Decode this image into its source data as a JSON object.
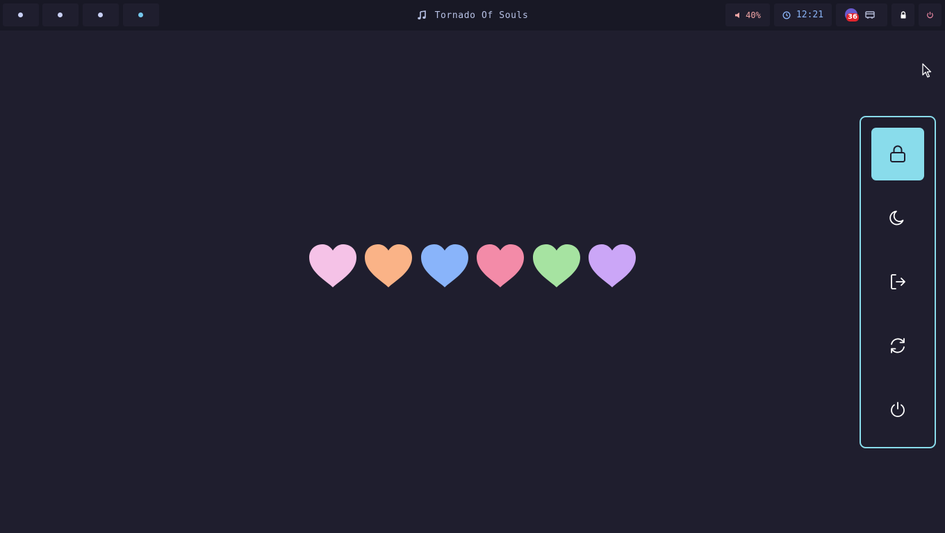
{
  "topbar": {
    "workspaces": [
      {
        "label": "workspace-1",
        "active": false
      },
      {
        "label": "workspace-2",
        "active": false
      },
      {
        "label": "workspace-3",
        "active": false
      },
      {
        "label": "workspace-4",
        "active": true
      }
    ],
    "now_playing": {
      "icon": "music-note-icon",
      "title": "Tornado Of Souls"
    },
    "volume": {
      "icon": "speaker-icon",
      "value": "40%"
    },
    "clock": {
      "icon": "clock-icon",
      "time": "12:21"
    },
    "tray": {
      "badge_count": "36",
      "items": [
        "notification-badge-icon",
        "network-icon"
      ]
    },
    "lock_icon": "lock-icon",
    "power_icon": "power-icon"
  },
  "hearts": [
    {
      "color": "#f5c2e7"
    },
    {
      "color": "#fab387"
    },
    {
      "color": "#89b4fa"
    },
    {
      "color": "#f38ba8"
    },
    {
      "color": "#a6e3a1"
    },
    {
      "color": "#cba6f7"
    }
  ],
  "power_menu": {
    "selected": "lock",
    "options": [
      {
        "name": "lock",
        "icon": "lock-icon"
      },
      {
        "name": "suspend",
        "icon": "moon-icon"
      },
      {
        "name": "logout",
        "icon": "logout-icon"
      },
      {
        "name": "reboot",
        "icon": "reboot-icon"
      },
      {
        "name": "shutdown",
        "icon": "power-icon"
      }
    ]
  },
  "colors": {
    "background": "#1f1e2e",
    "bar": "#181825",
    "accent": "#89dceb",
    "workspace_dot": "#c9d0f5",
    "workspace_active_dot": "#74c7ec",
    "volume": "#f2a6a6",
    "clock": "#8ab4f8",
    "power": "#f38ba8"
  }
}
